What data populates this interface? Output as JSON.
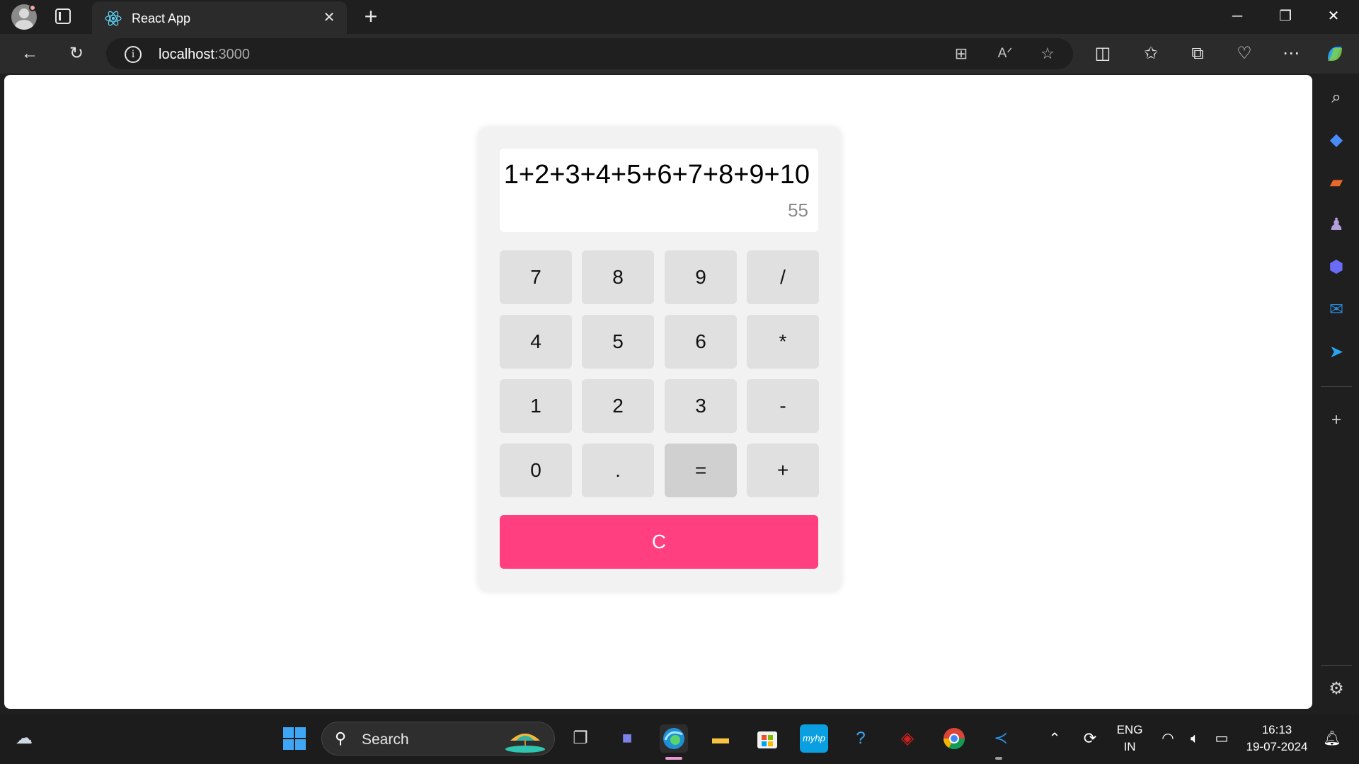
{
  "browser": {
    "tab_title": "React App",
    "url_host": "localhost",
    "url_port": ":3000"
  },
  "calculator": {
    "expression": "1+2+3+4+5+6+7+8+9+10",
    "result": "55",
    "keys": [
      [
        "7",
        "8",
        "9",
        "/"
      ],
      [
        "4",
        "5",
        "6",
        "*"
      ],
      [
        "1",
        "2",
        "3",
        "-"
      ],
      [
        "0",
        ".",
        "=",
        "+"
      ]
    ],
    "clear_label": "C",
    "colors": {
      "clear_button": "#ff3f7f",
      "key_bg": "#e0e0e0",
      "equals_bg": "#d0d0d0",
      "panel_bg": "#f2f2f2"
    }
  },
  "taskbar": {
    "search_label": "Search",
    "language": "ENG",
    "region": "IN",
    "time": "16:13",
    "date": "19-07-2024"
  }
}
